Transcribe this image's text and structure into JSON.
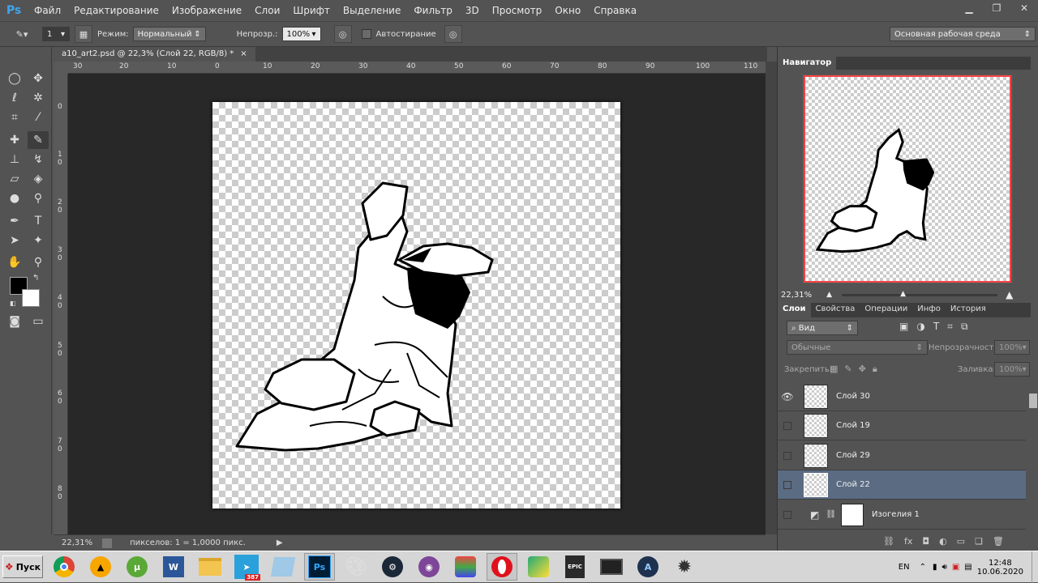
{
  "menubar": {
    "logo": "Ps",
    "items": [
      "Файл",
      "Редактирование",
      "Изображение",
      "Слои",
      "Шрифт",
      "Выделение",
      "Фильтр",
      "3D",
      "Просмотр",
      "Окно",
      "Справка"
    ]
  },
  "options": {
    "brush_size": "1",
    "mode_label": "Режим:",
    "mode_value": "Нормальный",
    "opacity_label": "Непрозр.:",
    "opacity_value": "100%",
    "autoerase_label": "Автостирание",
    "workspace": "Основная рабочая среда"
  },
  "document": {
    "tab_title": "a10_art2.psd @ 22,3% (Слой 22, RGB/8) *",
    "close_glyph": "×",
    "ruler_h": [
      "30",
      "20",
      "10",
      "0",
      "10",
      "20",
      "30",
      "40",
      "50",
      "60",
      "70",
      "80",
      "90",
      "100",
      "110"
    ],
    "ruler_v": [
      "0",
      "1 0",
      "2 0",
      "3 0",
      "4 0",
      "5 0",
      "6 0",
      "7 0",
      "8 0"
    ],
    "status_zoom": "22,31%",
    "status_info": "пикселов: 1 = 1,0000 пикс."
  },
  "navigator": {
    "tab": "Навигатор",
    "zoom": "22,31%"
  },
  "layers_panel": {
    "tabs": [
      "Слои",
      "Свойства",
      "Операции",
      "Инфо",
      "История"
    ],
    "filter_label": "Вид",
    "blend_mode": "Обычные",
    "opacity_label": "Непрозрачность:",
    "opacity_value": "100%",
    "lock_label": "Закрепить:",
    "fill_label": "Заливка:",
    "fill_value": "100%",
    "layers": [
      {
        "name": "Слой 30",
        "visible": true,
        "selected": false
      },
      {
        "name": "Слой 19",
        "visible": false,
        "selected": false
      },
      {
        "name": "Слой 29",
        "visible": false,
        "selected": false
      },
      {
        "name": "Слой 22",
        "visible": false,
        "selected": true
      },
      {
        "name": "Изогелия 1",
        "visible": false,
        "selected": false
      }
    ]
  },
  "taskbar": {
    "start": "Пуск",
    "telegram_badge": "387",
    "lang": "EN",
    "time": "12:48",
    "date": "10.06.2020"
  }
}
